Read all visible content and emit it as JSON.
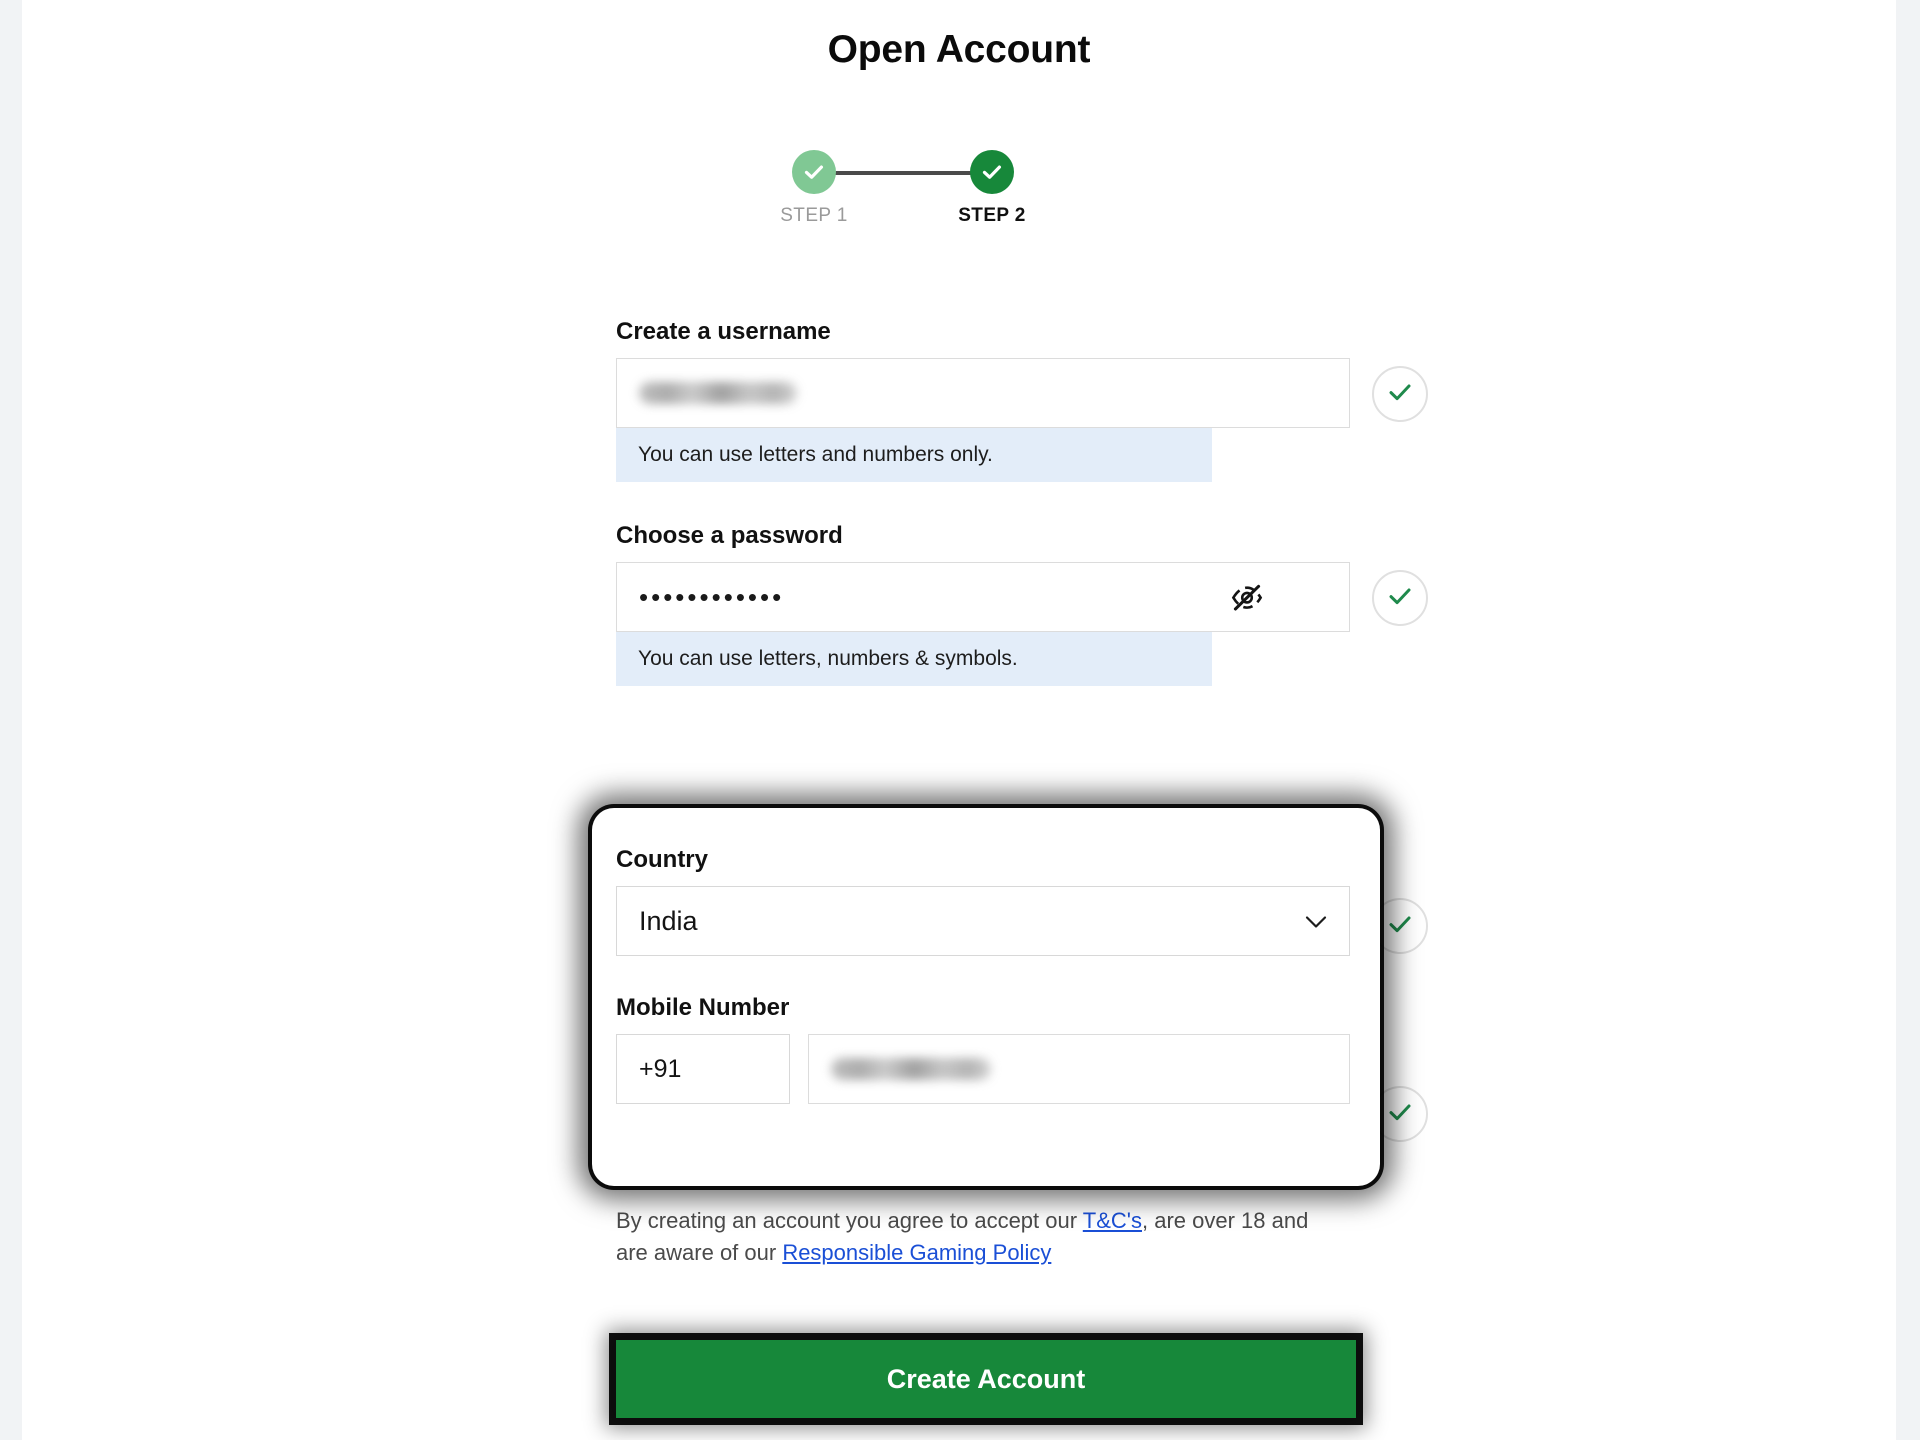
{
  "page": {
    "title": "Open Account",
    "background_color": "#f1f3f5",
    "sheet_color": "#ffffff"
  },
  "stepper": {
    "steps": [
      {
        "label": "STEP 1",
        "state": "done",
        "icon": "check-icon",
        "color": "#80c894"
      },
      {
        "label": "STEP 2",
        "state": "current",
        "icon": "check-icon",
        "color": "#17883a"
      }
    ]
  },
  "form": {
    "username": {
      "label": "Create a username",
      "value": "",
      "value_redacted": true,
      "hint": "You can use letters and numbers only.",
      "hint_bg": "#e3edf9",
      "valid": true,
      "valid_icon": "check-icon"
    },
    "password": {
      "label": "Choose a password",
      "value_masked": "••••••••••••",
      "mask_char_count": 12,
      "toggle_icon": "eye-off-icon",
      "hint": "You can use letters, numbers & symbols.",
      "hint_bg": "#e3edf9",
      "valid": true,
      "valid_icon": "check-icon"
    },
    "country": {
      "label": "Country",
      "selected": "India",
      "dropdown_icon": "chevron-down-icon",
      "valid": true,
      "valid_icon": "check-icon"
    },
    "mobile": {
      "label": "Mobile Number",
      "country_code": "+91",
      "value": "",
      "value_redacted": true,
      "valid": true,
      "valid_icon": "check-icon"
    }
  },
  "highlight": {
    "outline_color": "#000000",
    "targets": [
      "country",
      "mobile",
      "create-account-button"
    ]
  },
  "terms": {
    "part1": "By creating an account you agree to accept our ",
    "link1": "T&C's",
    "part2": ", are over 18 and are aware of our ",
    "link2": "Responsible Gaming Policy",
    "link_color": "#1a4fd6"
  },
  "submit": {
    "label": "Create Account",
    "color": "#17883a"
  }
}
